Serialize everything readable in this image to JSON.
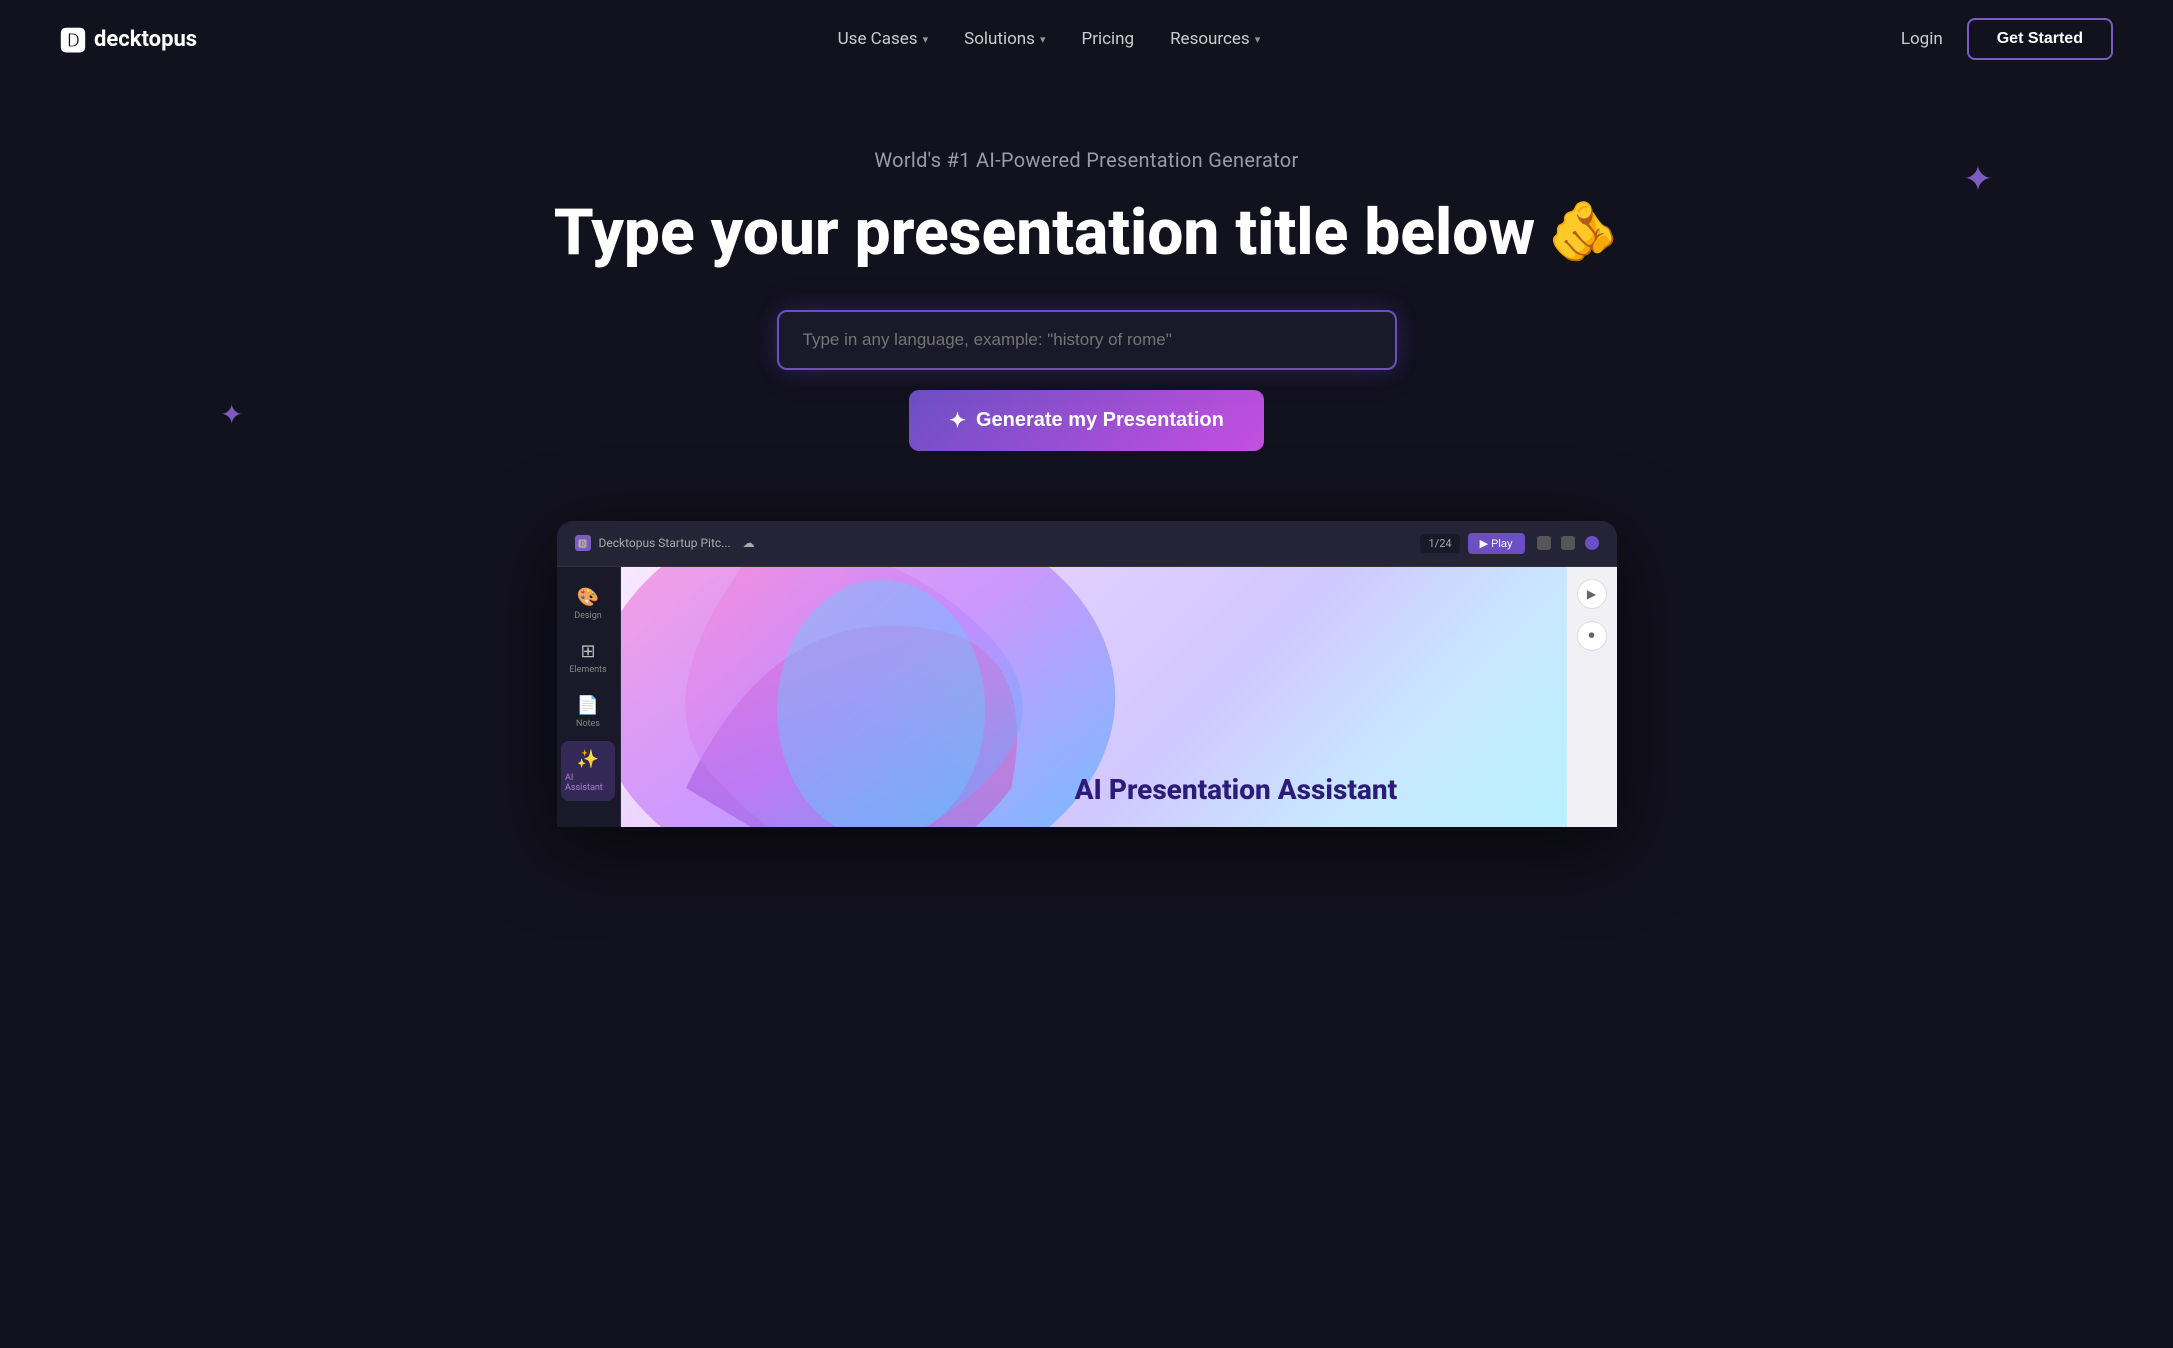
{
  "brand": {
    "logo_text": "decktopus",
    "logo_icon": "🅳"
  },
  "nav": {
    "links": [
      {
        "label": "Use Cases",
        "has_dropdown": true
      },
      {
        "label": "Solutions",
        "has_dropdown": true
      },
      {
        "label": "Pricing",
        "has_dropdown": false
      },
      {
        "label": "Resources",
        "has_dropdown": true
      }
    ],
    "login_label": "Login",
    "get_started_label": "Get Started"
  },
  "hero": {
    "subtitle": "World's #1 AI-Powered Presentation Generator",
    "title_text": "Type your presentation title below",
    "hand_emoji": "🫵"
  },
  "search": {
    "placeholder": "Type in any language, example: \"history of rome\""
  },
  "generate_button": {
    "label": "Generate my Presentation",
    "icon": "✦"
  },
  "preview": {
    "tab_title": "Decktopus Startup Pitc...",
    "page_counter": "1/24",
    "play_label": "▶ Play",
    "tools": [
      {
        "icon": "🎨",
        "label": "Design"
      },
      {
        "icon": "⊞",
        "label": "Elements"
      },
      {
        "icon": "📄",
        "label": "Notes"
      },
      {
        "icon": "✨",
        "label": "AI Assistant",
        "is_ai": true
      }
    ],
    "slide_title": "AI Presentation Assistant"
  },
  "decorative": {
    "star_large": "✦",
    "star_small": "✦"
  }
}
